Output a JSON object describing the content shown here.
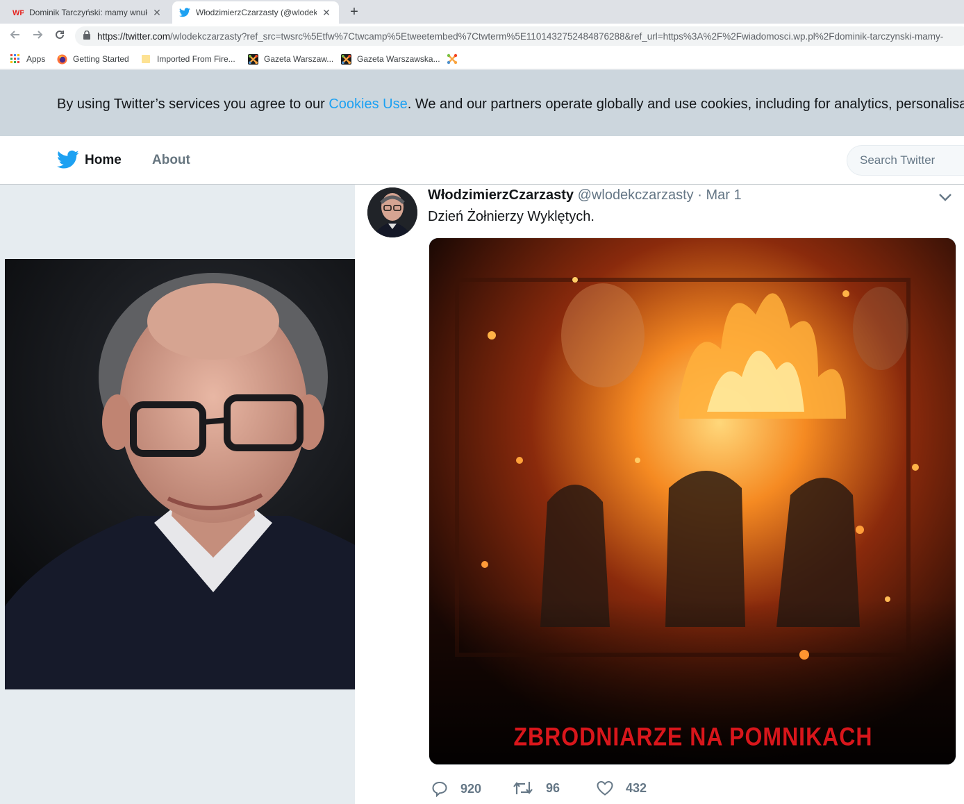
{
  "browser": {
    "tabs": [
      {
        "label": "Dominik Tarczyński: mamy wnuk",
        "favicon": "wp-icon",
        "active": false
      },
      {
        "label": "WłodzimierzCzarzasty (@wlodek",
        "favicon": "twitter-icon",
        "active": true
      }
    ],
    "url": {
      "host": "https://twitter.com",
      "path": "/wlodekczarzasty?ref_src=twsrc%5Etfw%7Ctwcamp%5Etweetembed%7Ctwterm%5E1101432752484876288&ref_url=https%3A%2F%2Fwiadomosci.wp.pl%2Fdominik-tarczynski-mamy-"
    },
    "bookmarks": [
      {
        "label": "Apps",
        "icon": "apps-grid-icon"
      },
      {
        "label": "Getting Started",
        "icon": "firefox-icon"
      },
      {
        "label": "Imported From Fire...",
        "icon": "folder-icon"
      },
      {
        "label": "Gazeta Warszaw...",
        "icon": "joomla-icon"
      },
      {
        "label": "Gazeta Warszawska...",
        "icon": "joomla-icon"
      }
    ]
  },
  "cookie_notice": {
    "before": "By using Twitter’s services you agree to our ",
    "link": "Cookies Use",
    "after": ". We and our partners operate globally and use cookies, including for analytics, personalisation, and ads."
  },
  "nav": {
    "home": "Home",
    "about": "About",
    "search_placeholder": "Search Twitter"
  },
  "tweet": {
    "fullname": "WłodzimierzCzarzasty",
    "handle": "@wlodekczarzasty",
    "separator": "·",
    "time": "Mar 1",
    "text": "Dzień Żołnierzy Wyklętych.",
    "media_caption": "ZBRODNIARZE NA POMNIKACH",
    "replies": "920",
    "retweets": "96",
    "likes": "432"
  },
  "colors": {
    "twitter_blue": "#1da1f2",
    "cookie_bar": "#ccd6dd",
    "page_bg": "#e6ecf0",
    "caption_red": "#d8161b"
  }
}
